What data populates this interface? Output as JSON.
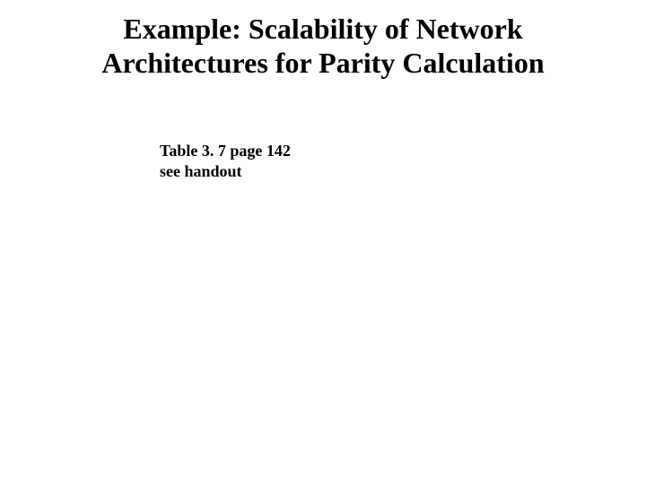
{
  "slide": {
    "title_line1": "Example: Scalability of Network",
    "title_line2": "Architectures for Parity Calculation",
    "note_line1": "Table 3. 7 page 142",
    "note_line2": "see handout"
  }
}
